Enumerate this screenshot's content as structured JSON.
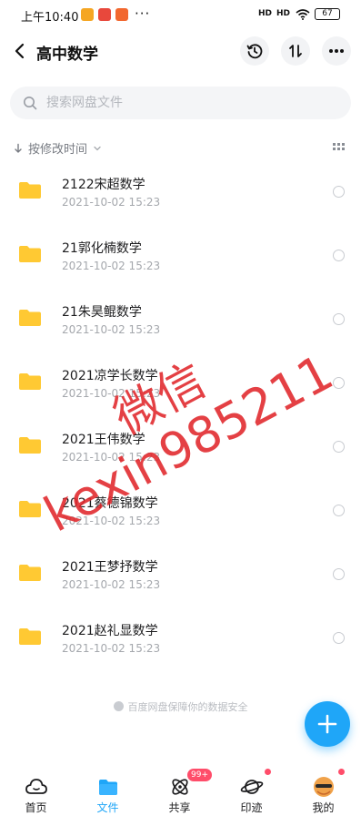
{
  "status_bar": {
    "time": "上午10:40",
    "signal_1": "HD",
    "signal_2": "HD",
    "battery": "67"
  },
  "header": {
    "title": "高中数学"
  },
  "search": {
    "placeholder": "搜索网盘文件"
  },
  "sort": {
    "label": "按修改时间"
  },
  "files": [
    {
      "name": "2122宋超数学",
      "date": "2021-10-02  15:23"
    },
    {
      "name": "21郭化楠数学",
      "date": "2021-10-02  15:23"
    },
    {
      "name": "21朱昊鲲数学",
      "date": "2021-10-02  15:23"
    },
    {
      "name": "2021凉学长数学",
      "date": "2021-10-02  15:23"
    },
    {
      "name": "2021王伟数学",
      "date": "2021-10-02  15:23"
    },
    {
      "name": "2021蔡德锦数学",
      "date": "2021-10-02  15:23"
    },
    {
      "name": "2021王梦抒数学",
      "date": "2021-10-02  15:23"
    },
    {
      "name": "2021赵礼显数学",
      "date": "2021-10-02  15:23"
    }
  ],
  "watermark": {
    "line1": "微信",
    "line2": "kexin985211"
  },
  "footer_note": "百度网盘保障你的数据安全",
  "nav": {
    "items": [
      {
        "label": "首页"
      },
      {
        "label": "文件"
      },
      {
        "label": "共享"
      },
      {
        "label": "印迹"
      },
      {
        "label": "我的"
      }
    ],
    "share_badge": "99+"
  },
  "colors": {
    "accent": "#1fa6f8",
    "folder": "#ffc933",
    "watermark": "#e0262a",
    "badge": "#ff4d6a"
  }
}
